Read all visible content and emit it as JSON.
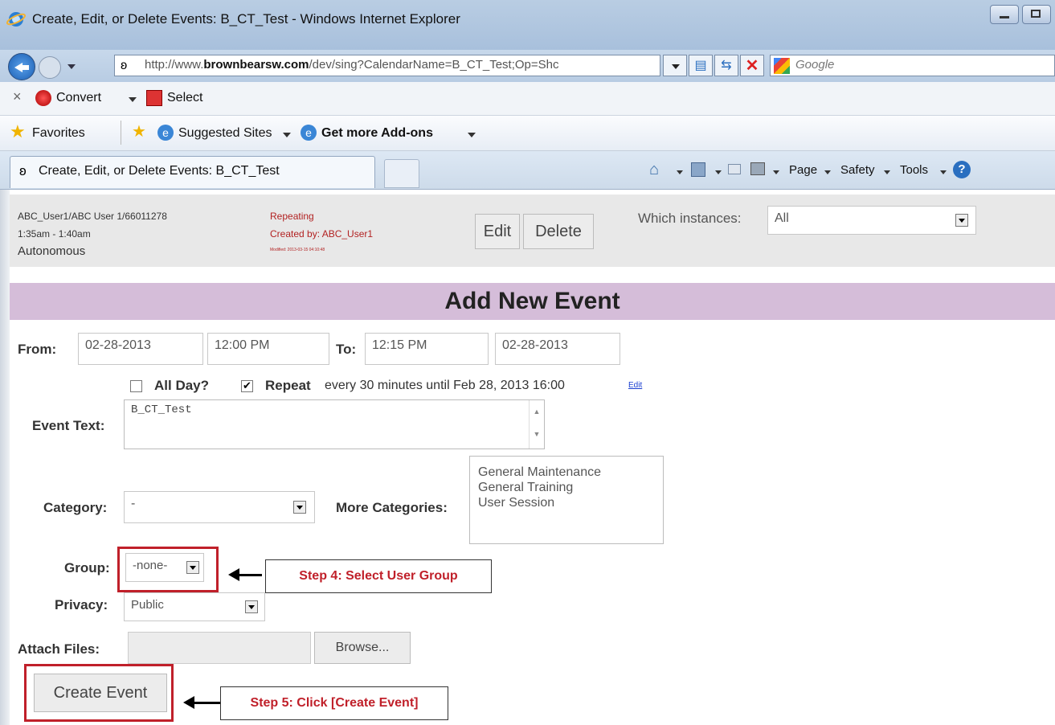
{
  "browser": {
    "window_title": "Create, Edit, or Delete Events: B_CT_Test - Windows Internet Explorer",
    "address_prefix": "http://www.",
    "address_domain": "brownbearsw.com",
    "address_rest": "/dev/sing?CalendarName=B_CT_Test;Op=Shc",
    "search_placeholder": "Google",
    "convert_label": "Convert",
    "select_label": "Select",
    "favorites_label": "Favorites",
    "suggested_sites_label": "Suggested Sites",
    "addons_label": "Get more Add-ons",
    "tab_title": "Create, Edit, or Delete Events: B_CT_Test",
    "page_menu": "Page",
    "safety_menu": "Safety",
    "tools_menu": "Tools"
  },
  "existing_event": {
    "user": "ABC_User1/ABC User 1/66011278",
    "time": "1:35am - 1:40am",
    "category": "Autonomous",
    "repeat_label": "Repeating",
    "created_by": "Created by: ABC_User1",
    "modified": "Modified: 2013-03-15 04:10:48",
    "edit_button": "Edit",
    "delete_button": "Delete",
    "which_instances_label": "Which instances:",
    "which_instances_value": "All"
  },
  "form": {
    "heading": "Add New Event",
    "from_label": "From:",
    "from_date": "02-28-2013",
    "from_time": "12:00 PM",
    "to_label": "To:",
    "to_time": "12:15 PM",
    "to_date": "02-28-2013",
    "all_day_label": "All Day?",
    "repeat_label": "Repeat",
    "repeat_text": "every 30 minutes until Feb 28, 2013 16:00",
    "repeat_edit_link": "Edit",
    "event_text_label": "Event Text:",
    "event_text_value": "B_CT_Test",
    "category_label": "Category:",
    "category_value": "-",
    "more_categories_label": "More Categories:",
    "more_categories_options": [
      "General Maintenance",
      "General Training",
      "User Session"
    ],
    "group_label": "Group:",
    "group_value": "-none-",
    "privacy_label": "Privacy:",
    "privacy_value": "Public",
    "attach_label": "Attach Files:",
    "browse_button": "Browse...",
    "create_button": "Create Event"
  },
  "annotations": {
    "step4": "Step 4: Select User Group",
    "step5": "Step 5: Click [Create Event]"
  },
  "colors": {
    "band": "#d5bdd9",
    "callout_red": "#c0202a"
  }
}
